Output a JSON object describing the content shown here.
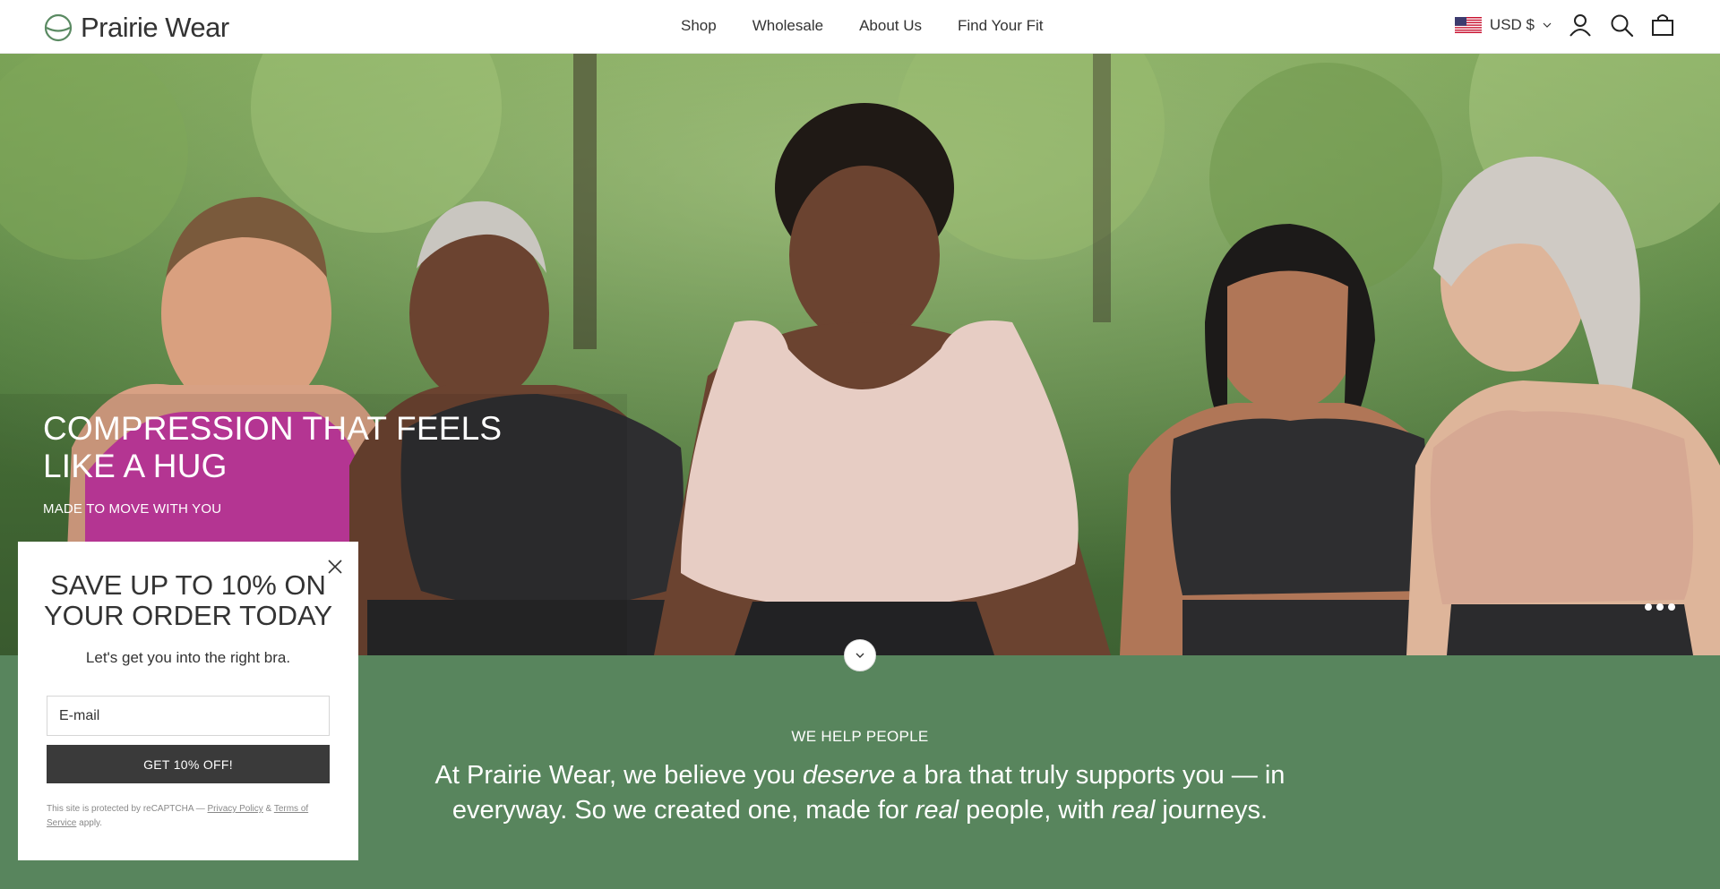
{
  "brand": {
    "name": "Prairie Wear"
  },
  "nav": [
    {
      "label": "Shop"
    },
    {
      "label": "Wholesale"
    },
    {
      "label": "About Us"
    },
    {
      "label": "Find Your Fit"
    }
  ],
  "header": {
    "currency": "USD $",
    "icons": [
      "us-flag-icon",
      "account-icon",
      "search-icon",
      "cart-icon"
    ]
  },
  "hero": {
    "title": "COMPRESSION THAT FEELS LIKE A HUG",
    "subtitle": "MADE TO MOVE WITH YOU",
    "slide_count": 3
  },
  "mission": {
    "eyebrow": "WE HELP PEOPLE",
    "part1": "At Prairie Wear, we believe you ",
    "em1": "deserve",
    "part2": " a bra that truly supports you — in everyway.  So we created one, made for ",
    "em2": "real",
    "part3": " people, with ",
    "em3": "real",
    "part4": " journeys."
  },
  "popup": {
    "title": "SAVE UP TO 10% ON YOUR ORDER TODAY",
    "text": "Let's get you into the right bra.",
    "email_placeholder": "E-mail",
    "button": "GET 10% OFF!",
    "legal_prefix": "This site is protected by reCAPTCHA — ",
    "privacy_link": "Privacy Policy",
    "legal_and": " & ",
    "terms_link": "Terms of Service",
    "legal_suffix": " apply."
  },
  "colors": {
    "section_green": "#58855d",
    "button_dark": "#3a3a3a",
    "bra_magenta": "#c43a9f",
    "bra_black": "#2e2e30",
    "bra_nude": "#e7cdc4"
  }
}
